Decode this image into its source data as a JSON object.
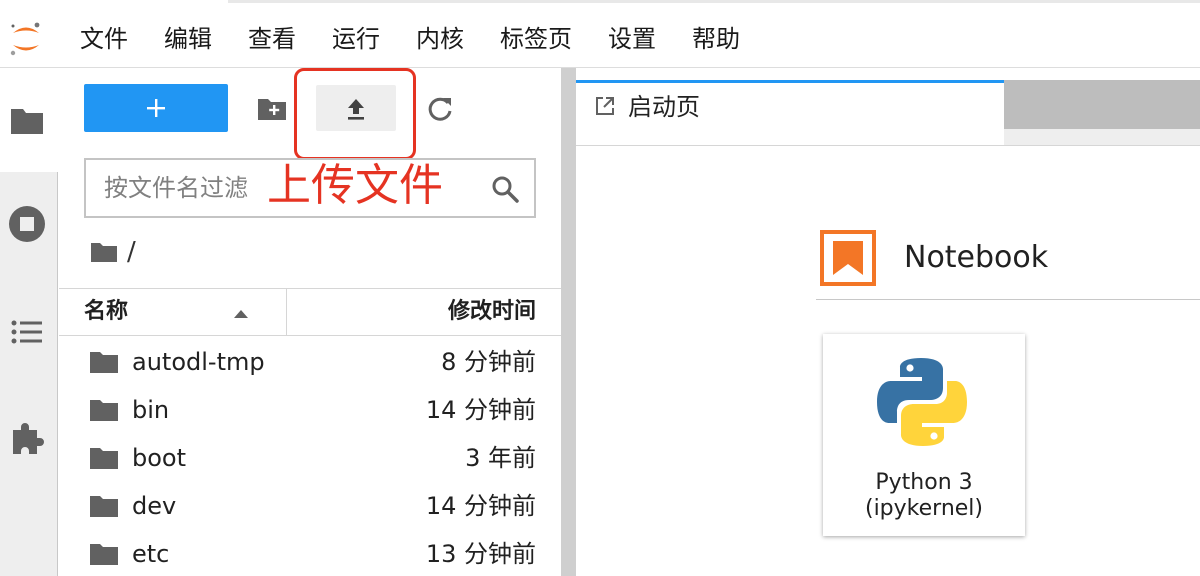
{
  "menu": {
    "items": [
      "文件",
      "编辑",
      "查看",
      "运行",
      "内核",
      "标签页",
      "设置",
      "帮助"
    ]
  },
  "annotation": {
    "label": "上传文件"
  },
  "filter": {
    "placeholder": "按文件名过滤"
  },
  "breadcrumb": {
    "path": "/"
  },
  "file_list": {
    "headers": {
      "name": "名称",
      "modified": "修改时间"
    },
    "rows": [
      {
        "name": "autodl-tmp",
        "modified": "8 分钟前"
      },
      {
        "name": "bin",
        "modified": "14 分钟前"
      },
      {
        "name": "boot",
        "modified": "3 年前"
      },
      {
        "name": "dev",
        "modified": "14 分钟前"
      },
      {
        "name": "etc",
        "modified": "13 分钟前"
      }
    ]
  },
  "main": {
    "tab": {
      "label": "启动页"
    },
    "launcher": {
      "section_title": "Notebook",
      "kernel": {
        "name": "Python 3",
        "sub": "(ipykernel)"
      }
    }
  },
  "colors": {
    "accent": "#2196f3",
    "annotation": "#e53322",
    "notebook_icon": "#f37626",
    "python_blue": "#3772a4",
    "python_yellow": "#ffd43b"
  },
  "icons": {
    "rail": [
      "folder-icon",
      "stop-circle-icon",
      "list-icon",
      "puzzle-icon"
    ],
    "toolbar": [
      "plus-icon",
      "new-folder-icon",
      "upload-icon",
      "refresh-icon"
    ]
  }
}
